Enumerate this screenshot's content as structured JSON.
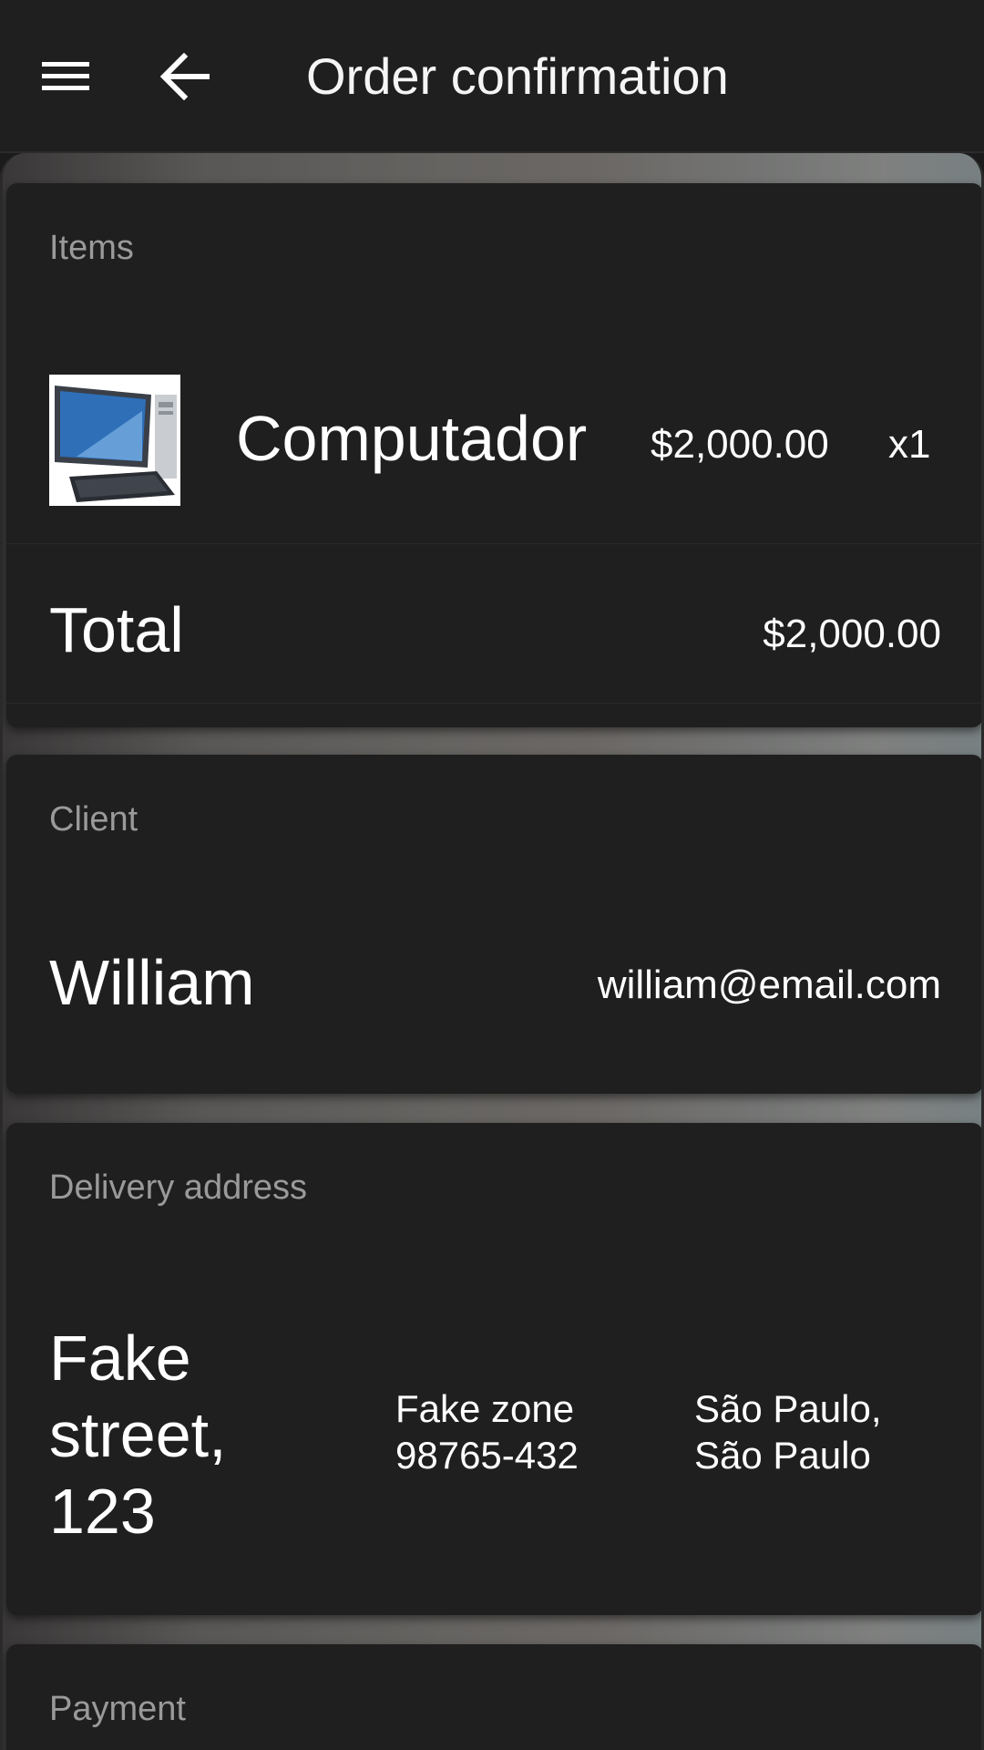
{
  "appbar": {
    "title": "Order confirmation",
    "menu_icon": "menu-icon",
    "back_icon": "arrow-back-icon"
  },
  "items": {
    "label": "Items",
    "products": [
      {
        "name": "Computador",
        "price": "$2,000.00",
        "quantity": "x1",
        "thumbnail": "computer-thumbnail"
      }
    ],
    "total_label": "Total",
    "total_value": "$2,000.00"
  },
  "client": {
    "label": "Client",
    "name": "William",
    "email": "william@email.com"
  },
  "delivery": {
    "label": "Delivery address",
    "street": "Fake street, 123",
    "zone": "Fake zone 98765-432",
    "city": "São Paulo, São Paulo"
  },
  "payment": {
    "label": "Payment"
  },
  "colors": {
    "surface": "#1f1f1f",
    "label": "#9a9a9a",
    "text": "#ffffff"
  }
}
